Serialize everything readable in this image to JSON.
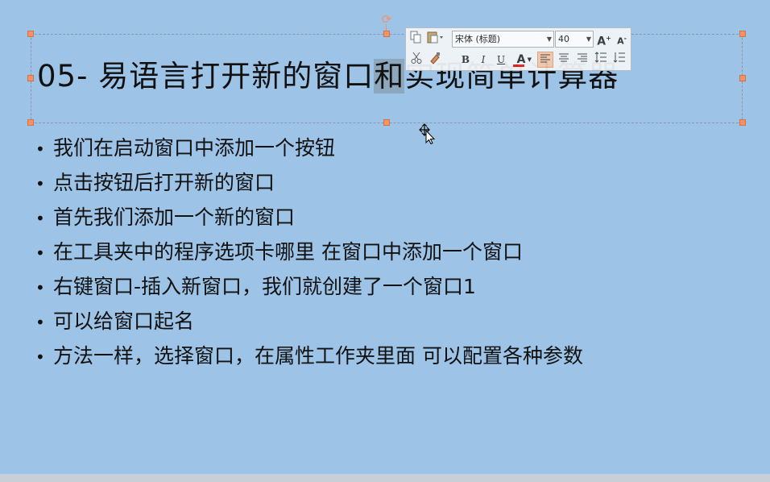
{
  "slide": {
    "title_prefix": "05- 易语言打开新的窗口",
    "title_selected": "和",
    "title_suffix": "实现简单计算器",
    "bullets": [
      "我们在启动窗口中添加一个按钮",
      "点击按钮后打开新的窗口",
      "首先我们添加一个新的窗口",
      "在工具夹中的程序选项卡哪里 在窗口中添加一个窗口",
      "右键窗口-插入新窗口，我们就创建了一个窗口1",
      "可以给窗口起名",
      "方法一样，选择窗口，在属性工作夹里面 可以配置各种参数"
    ],
    "bullet_char": "•"
  },
  "mini_toolbar": {
    "font_name": "宋体 (标题)",
    "font_size": "40",
    "grow_font": "A",
    "shrink_font": "A",
    "bold": "B",
    "italic": "I",
    "underline": "U",
    "font_color": "A"
  },
  "colors": {
    "slide_bg": "#9dc3e6",
    "handle": "#f0936a",
    "font_color_bar": "#e02020"
  },
  "icons": [
    "copy-icon",
    "paste-icon",
    "cut-icon",
    "format-painter-icon",
    "align-left-icon",
    "align-center-icon",
    "align-right-icon",
    "line-spacing-icon",
    "paragraph-spacing-icon",
    "rotate-icon",
    "move-cursor-icon"
  ]
}
